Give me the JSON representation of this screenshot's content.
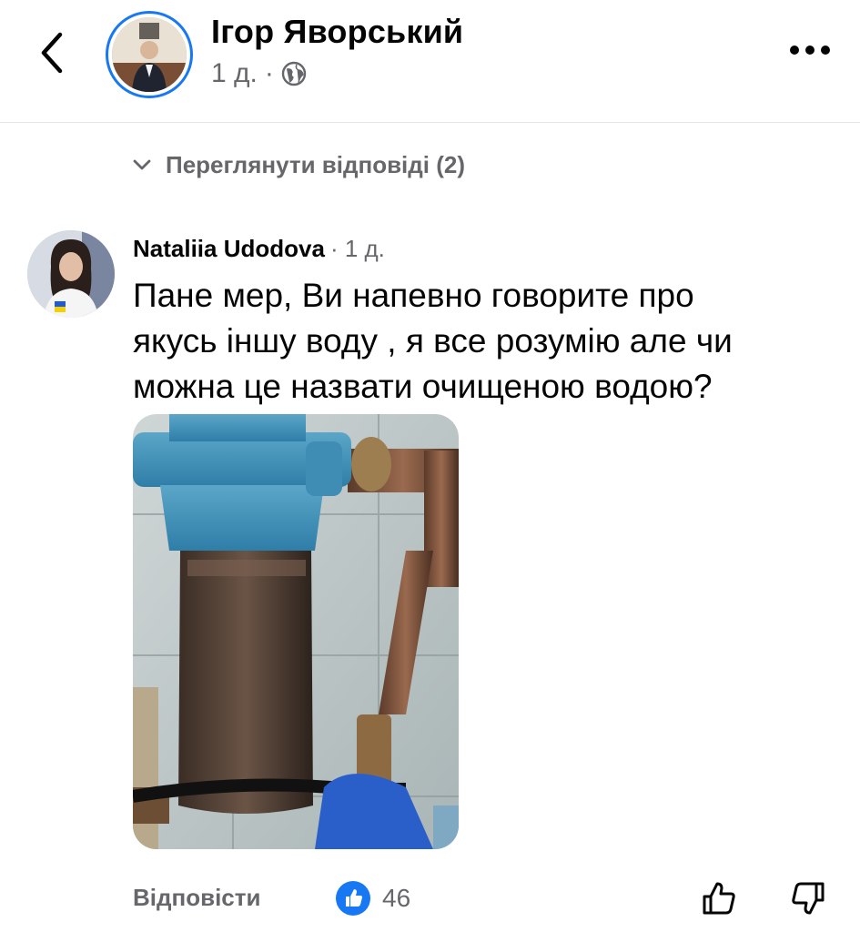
{
  "header": {
    "title": "Ігор Яворський",
    "time": "1 д.",
    "separator": "·",
    "back_icon": "chevron-left-icon",
    "privacy_icon": "globe-icon",
    "more_icon": "more-horizontal-icon"
  },
  "replies_toggle": {
    "label": "Переглянути відповіді (2)",
    "icon": "chevron-down-icon"
  },
  "comment": {
    "author": "Nataliia Udodova",
    "time": "· 1 д.",
    "text_lines": [
      "Пане мер, Ви напевно говорите про",
      "якусь іншу воду , я все розумію але чи",
      "можна це назвати очищеною водою?"
    ],
    "attachment": "photo"
  },
  "actions": {
    "reply_label": "Відповісти",
    "like_count": "46",
    "like_icon": "thumbs-up-icon",
    "upvote_icon": "thumb-up-outline-icon",
    "downvote_icon": "thumb-down-outline-icon"
  },
  "colors": {
    "accent": "#1877f2",
    "secondary_text": "#65676b",
    "primary_text": "#050505"
  }
}
